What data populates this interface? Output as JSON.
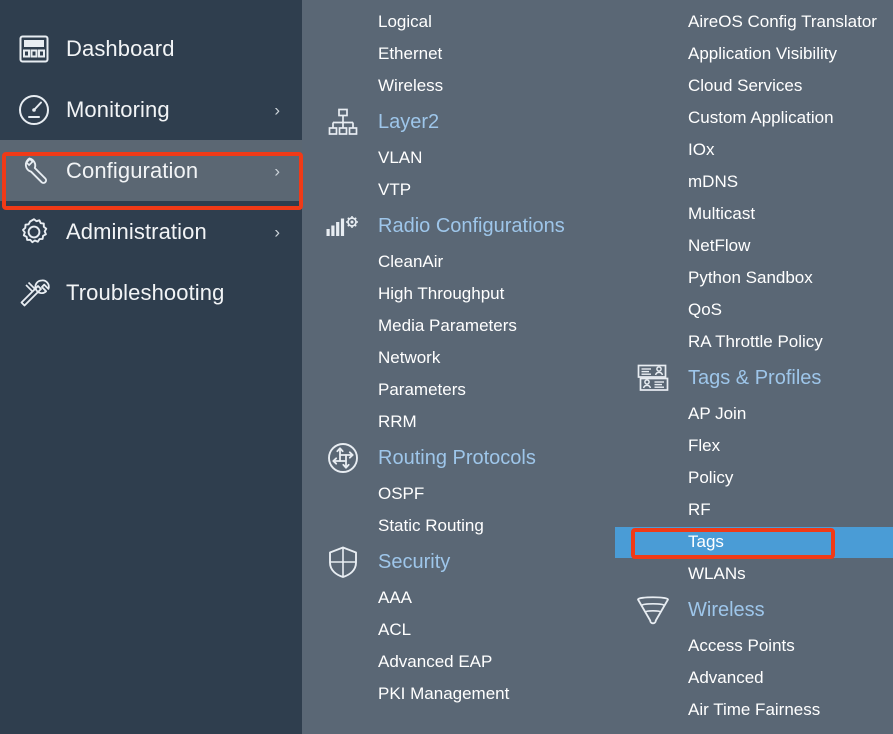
{
  "sidebar": {
    "items": [
      {
        "label": "Dashboard",
        "icon": "dashboard-icon",
        "chevron": "",
        "active": false
      },
      {
        "label": "Monitoring",
        "icon": "gauge-icon",
        "chevron": "›",
        "active": false
      },
      {
        "label": "Configuration",
        "icon": "wrench-icon",
        "chevron": "›",
        "active": true
      },
      {
        "label": "Administration",
        "icon": "gear-icon",
        "chevron": "›",
        "active": false
      },
      {
        "label": "Troubleshooting",
        "icon": "screwdriver-wrench-icon",
        "chevron": "",
        "active": false
      }
    ]
  },
  "flyout": {
    "middle_column": [
      {
        "type": "leaf",
        "label": "Logical"
      },
      {
        "type": "leaf",
        "label": "Ethernet"
      },
      {
        "type": "leaf",
        "label": "Wireless"
      },
      {
        "type": "group",
        "label": "Layer2",
        "icon": "hierarchy-icon"
      },
      {
        "type": "leaf",
        "label": "VLAN"
      },
      {
        "type": "leaf",
        "label": "VTP"
      },
      {
        "type": "group",
        "label": "Radio Configurations",
        "icon": "signal-gear-icon"
      },
      {
        "type": "leaf",
        "label": "CleanAir"
      },
      {
        "type": "leaf",
        "label": "High Throughput"
      },
      {
        "type": "leaf",
        "label": "Media Parameters"
      },
      {
        "type": "leaf",
        "label": "Network"
      },
      {
        "type": "leaf",
        "label": "Parameters"
      },
      {
        "type": "leaf",
        "label": "RRM"
      },
      {
        "type": "group",
        "label": "Routing Protocols",
        "icon": "routing-arrows-icon"
      },
      {
        "type": "leaf",
        "label": "OSPF"
      },
      {
        "type": "leaf",
        "label": "Static Routing"
      },
      {
        "type": "group",
        "label": "Security",
        "icon": "shield-icon"
      },
      {
        "type": "leaf",
        "label": "AAA"
      },
      {
        "type": "leaf",
        "label": "ACL"
      },
      {
        "type": "leaf",
        "label": "Advanced EAP"
      },
      {
        "type": "leaf",
        "label": "PKI Management"
      }
    ],
    "right_column": [
      {
        "type": "leaf",
        "label": "AireOS Config Translator"
      },
      {
        "type": "leaf",
        "label": "Application Visibility"
      },
      {
        "type": "leaf",
        "label": "Cloud Services"
      },
      {
        "type": "leaf",
        "label": "Custom Application"
      },
      {
        "type": "leaf",
        "label": "IOx"
      },
      {
        "type": "leaf",
        "label": "mDNS"
      },
      {
        "type": "leaf",
        "label": "Multicast"
      },
      {
        "type": "leaf",
        "label": "NetFlow"
      },
      {
        "type": "leaf",
        "label": "Python Sandbox"
      },
      {
        "type": "leaf",
        "label": "QoS"
      },
      {
        "type": "leaf",
        "label": "RA Throttle Policy"
      },
      {
        "type": "group",
        "label": "Tags & Profiles",
        "icon": "badge-cards-icon"
      },
      {
        "type": "leaf",
        "label": "AP Join"
      },
      {
        "type": "leaf",
        "label": "Flex"
      },
      {
        "type": "leaf",
        "label": "Policy"
      },
      {
        "type": "leaf",
        "label": "RF"
      },
      {
        "type": "leaf",
        "label": "Tags",
        "selected": true
      },
      {
        "type": "leaf",
        "label": "WLANs"
      },
      {
        "type": "group",
        "label": "Wireless",
        "icon": "wifi-cone-icon"
      },
      {
        "type": "leaf",
        "label": "Access Points"
      },
      {
        "type": "leaf",
        "label": "Advanced"
      },
      {
        "type": "leaf",
        "label": "Air Time Fairness"
      }
    ]
  },
  "annotations": {
    "highlight_color": "#f03a17",
    "boxes": [
      {
        "name": "configuration-callout",
        "target": "Configuration"
      },
      {
        "name": "tags-callout",
        "target": "Tags"
      }
    ]
  },
  "colors": {
    "sidebar_bg": "#2f3e4e",
    "panel_bg": "#5a6775",
    "active_row_bg": "#5b6773",
    "selection_blue": "#4a9cd6",
    "group_header_text": "#9ec6ea",
    "leaf_text": "#ffffff",
    "callout_red": "#f03a17"
  }
}
